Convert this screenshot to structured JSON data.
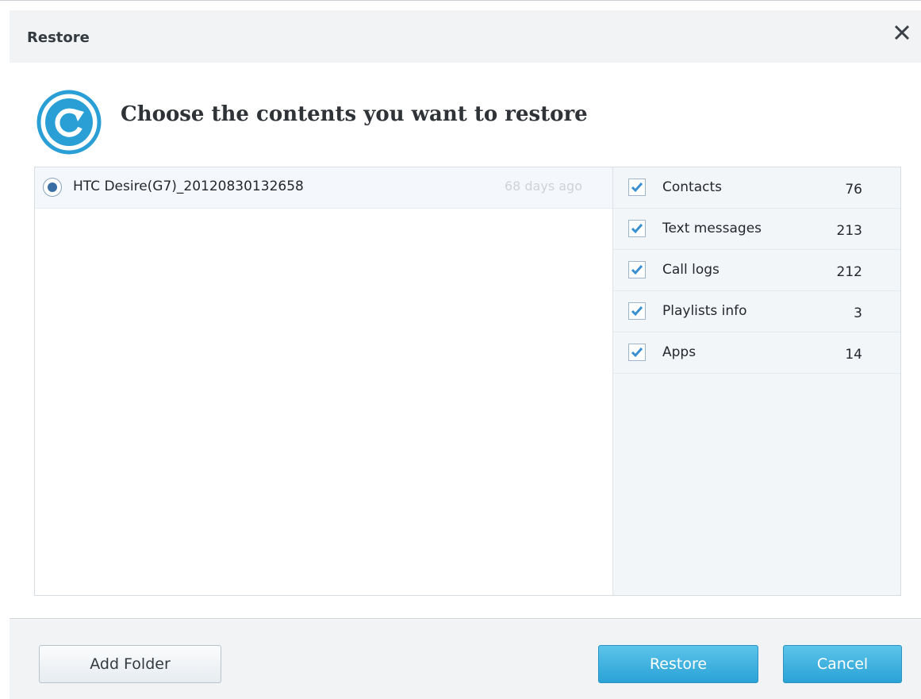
{
  "dialog": {
    "title": "Restore",
    "close_icon": "close-icon",
    "heading": "Choose the contents you want to restore",
    "heading_icon": "restore-icon"
  },
  "backups": [
    {
      "name": "HTC Desire(G7)_20120830132658",
      "age": "68 days ago",
      "selected": true
    }
  ],
  "contents": [
    {
      "label": "Contacts",
      "count": "76",
      "checked": true
    },
    {
      "label": "Text messages",
      "count": "213",
      "checked": true
    },
    {
      "label": "Call logs",
      "count": "212",
      "checked": true
    },
    {
      "label": "Playlists info",
      "count": "3",
      "checked": true
    },
    {
      "label": "Apps",
      "count": "14",
      "checked": true
    }
  ],
  "footer": {
    "add_folder_label": "Add Folder",
    "restore_label": "Restore",
    "cancel_label": "Cancel"
  },
  "colors": {
    "accent": "#2aa2d6",
    "check": "#3a8fd0"
  }
}
